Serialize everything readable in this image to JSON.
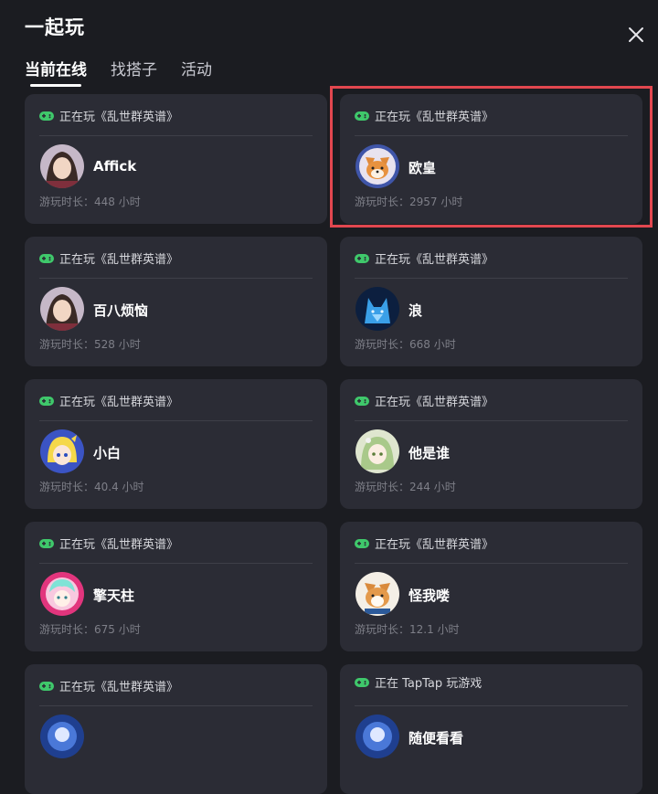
{
  "header": {
    "title": "一起玩"
  },
  "tabs": [
    {
      "label": "当前在线",
      "active": true
    },
    {
      "label": "找搭子",
      "active": false
    },
    {
      "label": "活动",
      "active": false
    }
  ],
  "cards": [
    {
      "status": "正在玩《乱世群英谱》",
      "name": "Affick",
      "duration": "游玩时长：448 小时",
      "avatar": "anime-girl-avatar"
    },
    {
      "status": "正在玩《乱世群英谱》",
      "name": "欧皇",
      "duration": "游玩时长：2957 小时",
      "avatar": "shiba-dog-avatar"
    },
    {
      "status": "正在玩《乱世群英谱》",
      "name": "百八烦恼",
      "duration": "游玩时长：528 小时",
      "avatar": "anime-girl-avatar"
    },
    {
      "status": "正在玩《乱世群英谱》",
      "name": "浪",
      "duration": "游玩时长：668 小时",
      "avatar": "blue-wolf-avatar"
    },
    {
      "status": "正在玩《乱世群英谱》",
      "name": "小白",
      "duration": "游玩时长：40.4 小时",
      "avatar": "blonde-chibi-avatar"
    },
    {
      "status": "正在玩《乱世群英谱》",
      "name": "他是谁",
      "duration": "游玩时长：244 小时",
      "avatar": "green-hair-girl-avatar"
    },
    {
      "status": "正在玩《乱世群英谱》",
      "name": "擎天柱",
      "duration": "游玩时长：675 小时",
      "avatar": "pink-chibi-avatar"
    },
    {
      "status": "正在玩《乱世群英谱》",
      "name": "怪我喽",
      "duration": "游玩时长：12.1 小时",
      "avatar": "corgi-dog-avatar"
    },
    {
      "status": "正在玩《乱世群英谱》",
      "name": "",
      "duration": "",
      "avatar": "blue-avatar"
    },
    {
      "status": "正在 TapTap 玩游戏",
      "name": "随便看看",
      "duration": "",
      "avatar": "blue-avatar"
    }
  ],
  "colors": {
    "gamepad": "#3fc86b",
    "highlight": "#e2474f",
    "card": "#2b2c35",
    "background": "#1b1c21"
  }
}
